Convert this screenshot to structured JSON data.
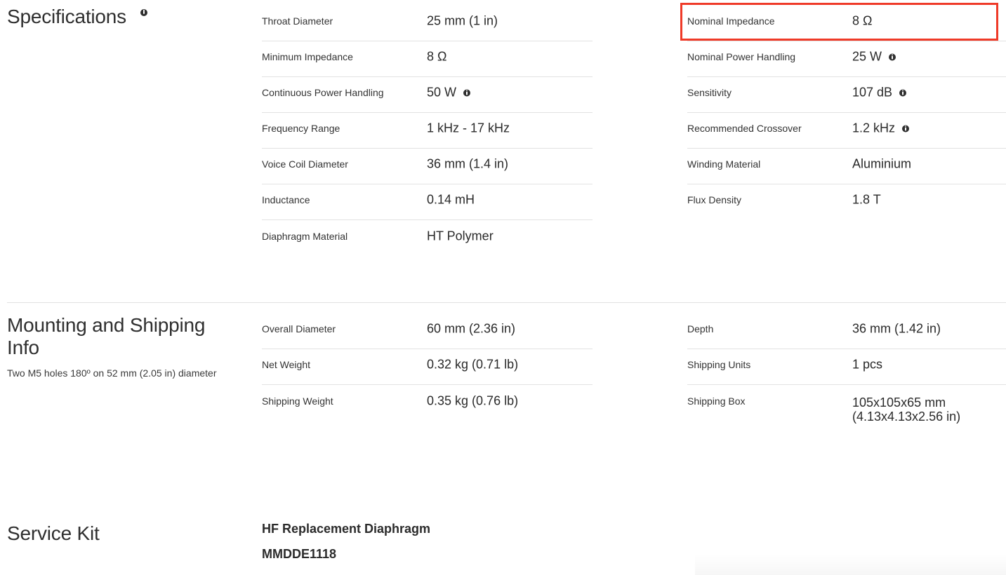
{
  "specifications": {
    "title": "Specifications",
    "left_rows": [
      {
        "label": "Throat Diameter",
        "value": "25 mm (1 in)"
      },
      {
        "label": "Minimum Impedance",
        "value": "8 Ω"
      },
      {
        "label": "Continuous Power Handling",
        "value": "50 W",
        "info": true
      },
      {
        "label": "Frequency Range",
        "value": "1 kHz - 17 kHz"
      },
      {
        "label": "Voice Coil Diameter",
        "value": "36 mm (1.4 in)"
      },
      {
        "label": "Inductance",
        "value": "0.14 mH"
      },
      {
        "label": "Diaphragm Material",
        "value": "HT Polymer"
      }
    ],
    "right_rows": [
      {
        "label": "Nominal Impedance",
        "value": "8 Ω"
      },
      {
        "label": "Nominal Power Handling",
        "value": "25 W",
        "info": true
      },
      {
        "label": "Sensitivity",
        "value": "107 dB",
        "info": true
      },
      {
        "label": "Recommended Crossover",
        "value": "1.2 kHz",
        "info": true
      },
      {
        "label": "Winding Material",
        "value": "Aluminium"
      },
      {
        "label": "Flux Density",
        "value": "1.8 T"
      }
    ]
  },
  "mounting": {
    "title": "Mounting and Shipping Info",
    "subtitle": "Two M5 holes 180º on 52 mm (2.05 in) diameter",
    "left_rows": [
      {
        "label": "Overall Diameter",
        "value": "60 mm (2.36 in)"
      },
      {
        "label": "Net Weight",
        "value": "0.32 kg (0.71 lb)"
      },
      {
        "label": "Shipping Weight",
        "value": "0.35 kg (0.76 lb)"
      }
    ],
    "right_rows": [
      {
        "label": "Depth",
        "value": "36 mm (1.42 in)"
      },
      {
        "label": "Shipping Units",
        "value": "1 pcs"
      },
      {
        "label": "Shipping Box",
        "value": "105x105x65 mm (4.13x4.13x2.56 in)"
      }
    ]
  },
  "service_kit": {
    "title": "Service Kit",
    "item_name": "HF Replacement Diaphragm",
    "item_code": "MMDDE1118"
  },
  "highlight": {
    "color": "#ef3a28",
    "target": "Nominal Impedance"
  }
}
